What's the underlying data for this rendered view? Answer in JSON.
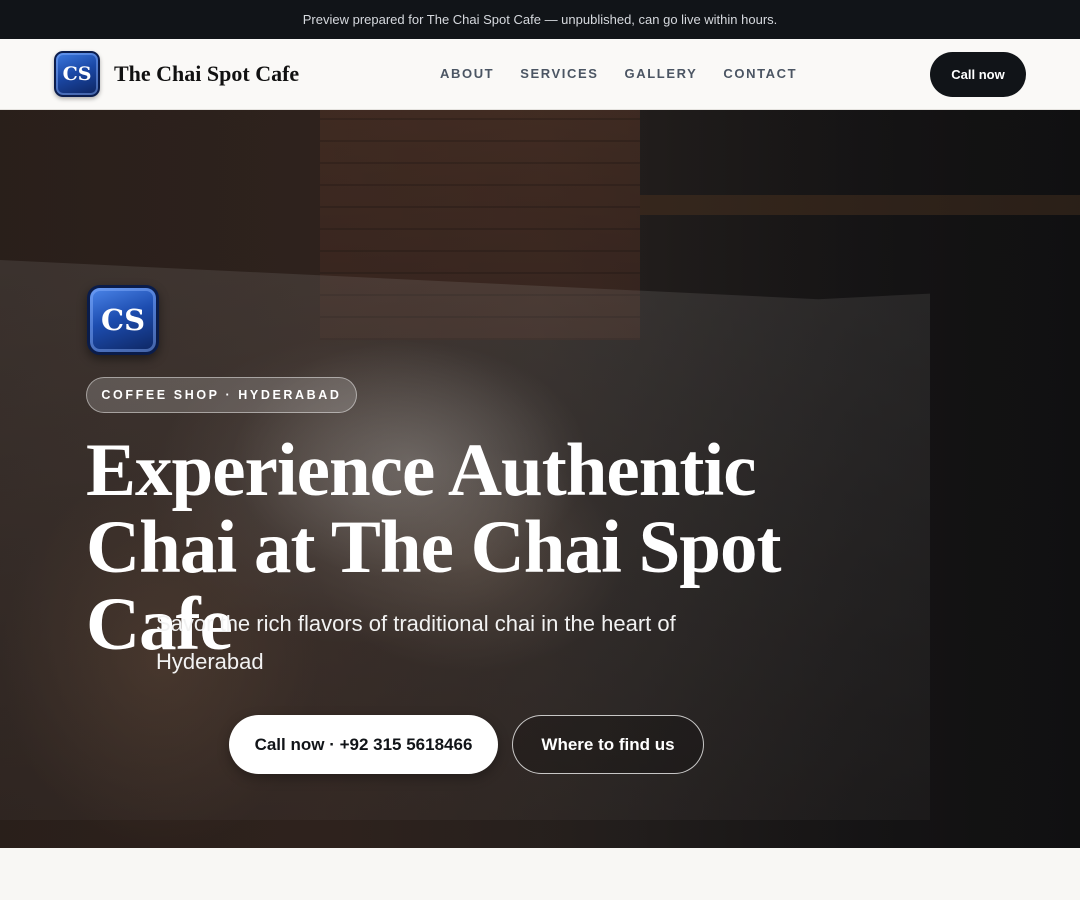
{
  "preview_bar": {
    "text": "Preview prepared for The Chai Spot Cafe — unpublished, can go live within hours."
  },
  "header": {
    "logo_text": "CS",
    "brand_name": "The Chai Spot Cafe",
    "nav": [
      "ABOUT",
      "SERVICES",
      "GALLERY",
      "CONTACT"
    ],
    "cta_label": "Call now"
  },
  "hero": {
    "logo_text": "CS",
    "tag": "COFFEE SHOP · HYDERABAD",
    "title": "Experience Authentic Chai at The Chai Spot Cafe",
    "subtitle": "Savor the rich flavors of traditional chai in the heart of Hyderabad",
    "primary_button": "Call now · +92 315 5618466",
    "secondary_button": "Where to find us"
  },
  "colors": {
    "header_dark": "#111418",
    "logo_blue": "#1b49a8",
    "page_bg": "#f8f7f4"
  }
}
